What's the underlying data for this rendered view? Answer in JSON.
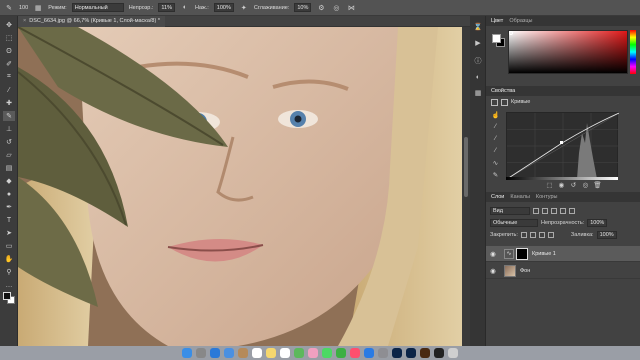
{
  "options_bar": {
    "tool_icon": "brush-icon",
    "brush_size": "100",
    "mode_label": "Режим:",
    "mode_value": "Нормальный",
    "opacity_label": "Непрозр.:",
    "opacity_value": "11%",
    "pressure_icon": "pressure-icon",
    "flow_label": "Наж.:",
    "flow_value": "100%",
    "airbrush_icon": "airbrush-icon",
    "smoothing_label": "Сглаживание:",
    "smoothing_value": "10%",
    "settings_icon": "gear-icon",
    "symmetry_icon": "butterfly-icon"
  },
  "document": {
    "tab_title": "DSC_6634.jpg @ 66,7% (Кривые 1, Слой-маска/8) *"
  },
  "tools": [
    "move-icon",
    "marquee-icon",
    "lasso-icon",
    "quick-select-icon",
    "crop-icon",
    "eyedropper-icon",
    "healing-icon",
    "brush-icon",
    "stamp-icon",
    "history-brush-icon",
    "eraser-icon",
    "gradient-icon",
    "blur-icon",
    "dodge-icon",
    "pen-icon",
    "type-icon",
    "path-select-icon",
    "shape-icon",
    "hand-icon",
    "zoom-icon",
    "more-icon"
  ],
  "color_panel": {
    "tabs": [
      "Цвет",
      "Образцы"
    ],
    "accent": "#e01818"
  },
  "properties_panel": {
    "title": "Свойства",
    "adjustment_label": "Кривые"
  },
  "layers_panel": {
    "tabs": [
      "Слои",
      "Каналы",
      "Контуры"
    ],
    "filter_label": "Вид",
    "blend_mode": "Обычные",
    "opacity_label": "Непрозрачность:",
    "opacity_value": "100%",
    "lock_label": "Закрепить:",
    "fill_label": "Заливка:",
    "fill_value": "100%",
    "layers": [
      {
        "name": "Кривые 1",
        "visible": true,
        "selected": true
      },
      {
        "name": "Фон",
        "visible": true,
        "selected": false
      }
    ]
  },
  "dock": {
    "apps": [
      "finder",
      "launchpad",
      "safari",
      "mail",
      "contacts",
      "calendar",
      "notes",
      "reminders",
      "maps",
      "photos",
      "messages",
      "facetime",
      "music",
      "appstore",
      "preferences",
      "photoshop",
      "lightroom",
      "bridge",
      "terminal",
      "trash"
    ],
    "colors": [
      "#3a8ee6",
      "#888888",
      "#2b79d8",
      "#4a90e2",
      "#b58a5a",
      "#ffffff",
      "#f5d76e",
      "#ffffff",
      "#5cb85c",
      "#f0a0c0",
      "#4cd964",
      "#3cb043",
      "#ff4f6e",
      "#2a7be4",
      "#8e8e93",
      "#0b2447",
      "#0b2447",
      "#4a2a12",
      "#222222",
      "#cfcfcf"
    ]
  }
}
